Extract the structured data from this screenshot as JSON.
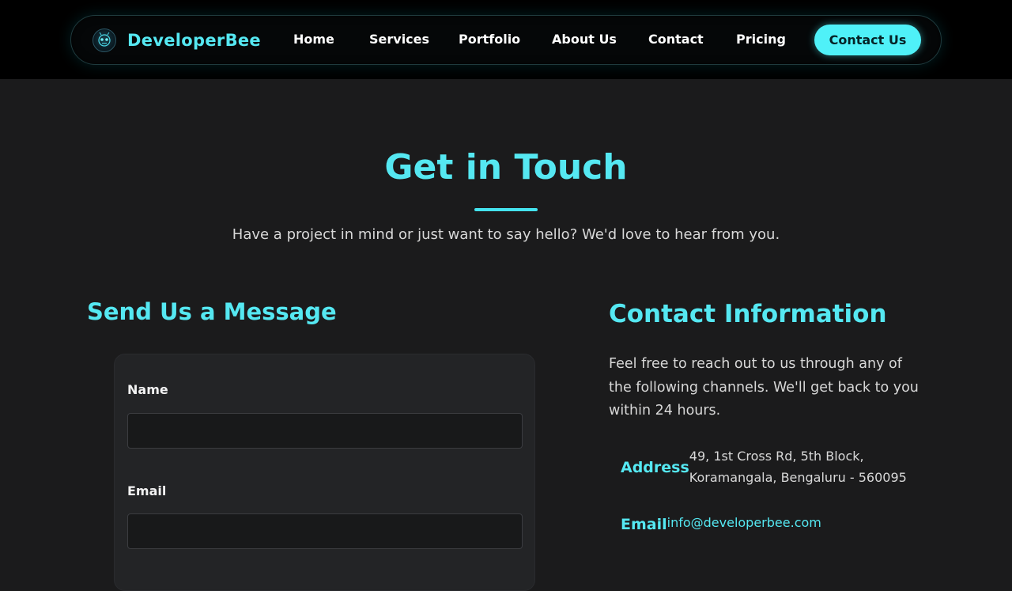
{
  "brand": {
    "name": "DeveloperBee",
    "logo_icon": "bee-robot-logo-icon",
    "accent": "#55e8f2"
  },
  "nav": {
    "links": [
      "Home",
      "Services",
      "Portfolio",
      "About Us",
      "Contact",
      "Pricing"
    ],
    "cta_label": "Contact Us"
  },
  "hero": {
    "title": "Get in Touch",
    "subtitle": "Have a project in mind or just want to say hello? We'd love to hear from you."
  },
  "form": {
    "heading": "Send Us a Message",
    "name_label": "Name",
    "name_value": "",
    "email_label": "Email",
    "email_value": ""
  },
  "contact_info": {
    "heading": "Contact Information",
    "description": "Feel free to reach out to us through any of the following channels. We'll get back to you within 24 hours.",
    "address_label": "Address",
    "address_line1": "49, 1st Cross Rd, 5th Block,",
    "address_line2": "Koramangala, Bengaluru - 560095",
    "email_label": "Email",
    "email_value": "info@developerbee.com"
  },
  "colors": {
    "background": "#1b1b1c",
    "topbar": "#000000",
    "cta_background": "#4ff1f8",
    "card": "#232426"
  }
}
